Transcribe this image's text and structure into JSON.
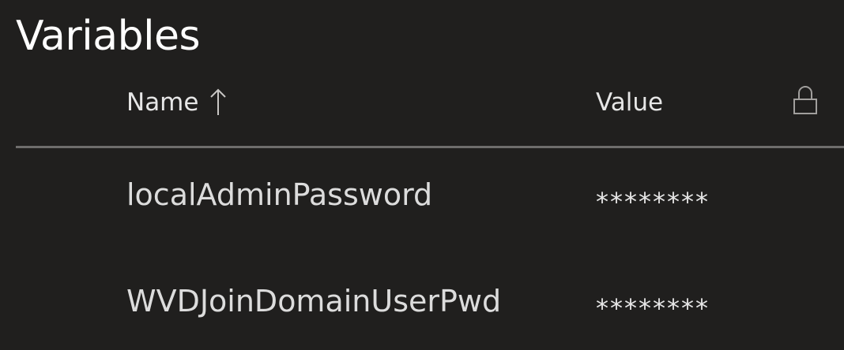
{
  "section": {
    "title": "Variables"
  },
  "table": {
    "columns": {
      "name": "Name",
      "value": "Value"
    },
    "sort": {
      "column": "Name",
      "direction": "ascending",
      "icon": "arrow-up-icon"
    },
    "lock_icon": "lock-icon",
    "rows": [
      {
        "name": "localAdminPassword",
        "value": "********"
      },
      {
        "name": "WVDJoinDomainUserPwd",
        "value": "********"
      }
    ]
  },
  "colors": {
    "background": "#201f1e",
    "text": "#f3f2f1",
    "divider": "#6e6d6c"
  }
}
